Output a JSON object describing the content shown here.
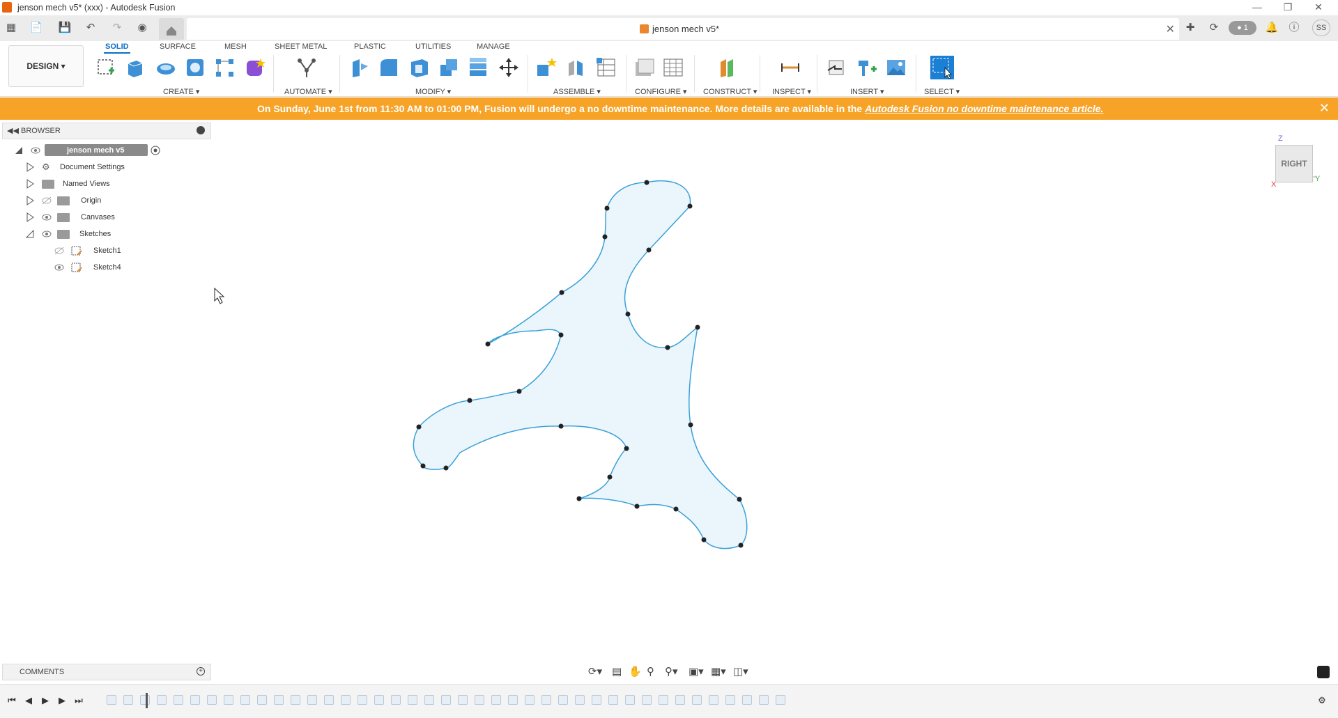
{
  "window": {
    "title": "jenson mech v5* (xxx) - Autodesk Fusion",
    "controls": [
      "minimize",
      "restore",
      "close"
    ]
  },
  "tabbar": {
    "document_tab": "jenson mech v5*",
    "badge_count": "1",
    "user_initials": "SS"
  },
  "ribbon": {
    "workspace_button": "DESIGN",
    "tabs": [
      "SOLID",
      "SURFACE",
      "MESH",
      "SHEET METAL",
      "PLASTIC",
      "UTILITIES",
      "MANAGE"
    ],
    "active_tab": "SOLID",
    "groups": [
      "CREATE",
      "AUTOMATE",
      "MODIFY",
      "ASSEMBLE",
      "CONFIGURE",
      "CONSTRUCT",
      "INSPECT",
      "INSERT",
      "SELECT"
    ]
  },
  "banner": {
    "text": "On Sunday, June 1st from 11:30 AM to 01:00 PM, Fusion will undergo a no downtime maintenance. More details are available in the",
    "link_text": "Autodesk Fusion no downtime maintenance article."
  },
  "browser": {
    "header": "BROWSER",
    "root": "jenson mech v5",
    "items": [
      "Document Settings",
      "Named Views",
      "Origin",
      "Canvases",
      "Sketches"
    ],
    "sketches": [
      "Sketch1",
      "Sketch4"
    ]
  },
  "viewcube": {
    "face_label": "RIGHT",
    "axis_z": "Z",
    "axis_y": "Y",
    "axis_x": "X"
  },
  "comments": {
    "label": "COMMENTS"
  },
  "colors": {
    "accent": "#0b6dc5",
    "banner": "#f7a327",
    "sketch_line": "#3aa0d8",
    "sketch_fill": "#eaf5fc"
  }
}
